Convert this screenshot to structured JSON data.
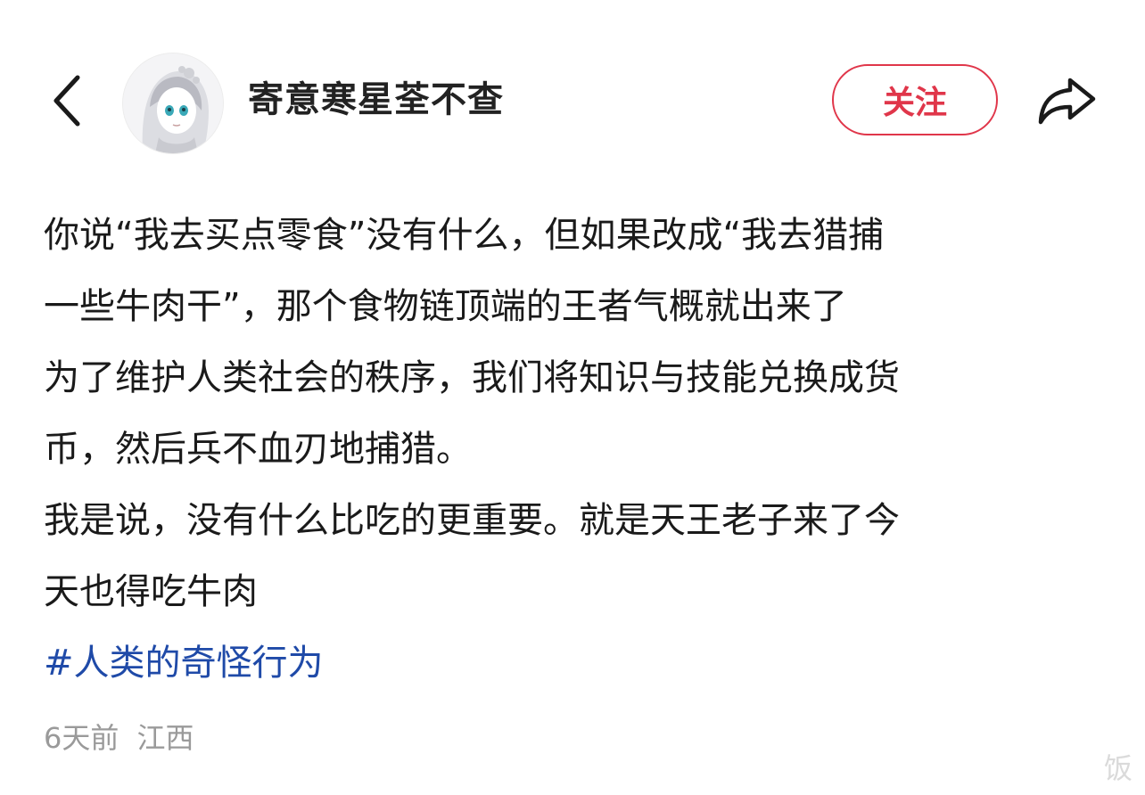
{
  "header": {
    "back_icon": "chevron-left-icon",
    "avatar_alt": "anime-girl-avatar",
    "username": "寄意寒星荃不查",
    "follow_label": "关注",
    "follow_color": "#e0364a",
    "share_icon": "share-arrow-icon"
  },
  "post": {
    "lines": [
      "你说“我去买点零食”没有什么，但如果改成“我去猎捕",
      "一些牛肉干”，那个食物链顶端的王者气概就出来了",
      "为了维护人类社会的秩序，我们将知识与技能兑换成货",
      "币，然后兵不血刃地捕猎。",
      "我是说，没有什么比吃的更重要。就是天王老子来了今",
      "天也得吃牛肉"
    ],
    "hashtag": "#人类的奇怪行为",
    "hashtag_color": "#1f4aa8"
  },
  "meta": {
    "time": "6天前",
    "location": "江西"
  },
  "watermark": {
    "text": "饭"
  }
}
